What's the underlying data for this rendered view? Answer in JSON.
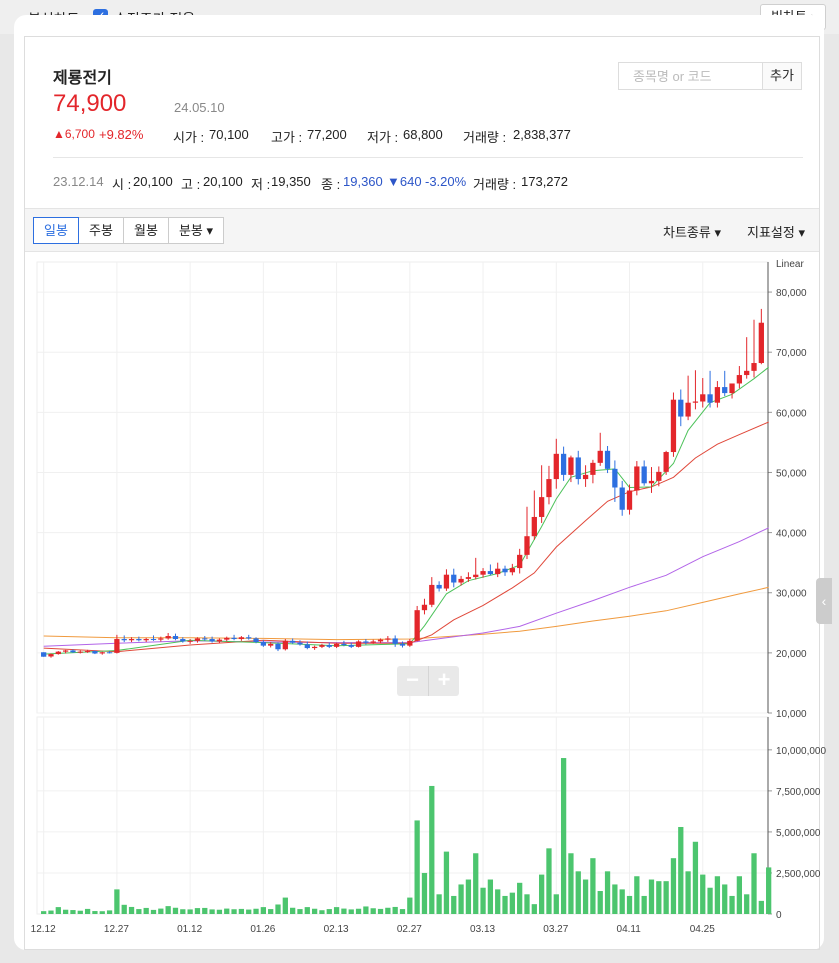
{
  "header": {
    "title": "분석차트",
    "adjusted_price_label": "수정주가 적용",
    "adjusted_price_checked": true,
    "big_chart_label": "빅차트 ›"
  },
  "stock": {
    "name": "제룡전기",
    "price": "74,900",
    "date": "24.05.10",
    "change": "▲6,700",
    "change_pct": "+9.82%",
    "open_label": "시가 :",
    "open": "70,100",
    "high_label": "고가 :",
    "high": "77,200",
    "low_label": "저가 :",
    "low": "68,800",
    "volume_label": "거래량 :",
    "volume": "2,838,377"
  },
  "search": {
    "placeholder": "종목명 or 코드",
    "add_label": "추가"
  },
  "hover_candle": {
    "date": "23.12.14",
    "open_label": "시 :",
    "open": "20,100",
    "high_label": "고 :",
    "high": "20,100",
    "low_label": "저 :",
    "low": "19,350",
    "close_label": "종 :",
    "close": "19,360",
    "change": "▼640",
    "change_pct": "-3.20%",
    "volume_label": "거래량 :",
    "volume": "173,272"
  },
  "toolbar": {
    "tabs": [
      "일봉",
      "주봉",
      "월봉",
      "분봉 ▾"
    ],
    "active_tab": 0,
    "chart_type_label": "차트종류 ▾",
    "indicator_label": "지표설정 ▾"
  },
  "colors": {
    "up": "#e3262b",
    "down": "#2d6fe0",
    "ma5": "#4cc25a",
    "ma20": "#e0483a",
    "ma60": "#b264e8",
    "ma120": "#f09a3e",
    "volume": "#4cc56e"
  },
  "chart_data": {
    "type": "candlestick",
    "scale_label": "Linear",
    "price_ticks": [
      "80,000",
      "70,000",
      "60,000",
      "50,000",
      "40,000",
      "30,000",
      "20,000",
      "10,000"
    ],
    "price_tick_values": [
      80000,
      70000,
      60000,
      50000,
      40000,
      30000,
      20000,
      10000
    ],
    "ylim": [
      10000,
      85000
    ],
    "volume_ticks": [
      "10,000,000",
      "7,500,000",
      "5,000,000",
      "2,500,000",
      "0"
    ],
    "volume_tick_values": [
      10000000,
      7500000,
      5000000,
      2500000,
      0
    ],
    "volume_ylim": [
      0,
      12000000
    ],
    "x_labels": [
      "12.12",
      "12.27",
      "01.12",
      "01.26",
      "02.13",
      "02.27",
      "03.13",
      "03.27",
      "04.11",
      "04.25"
    ],
    "x_label_index": [
      0,
      10,
      20,
      30,
      40,
      50,
      60,
      70,
      80,
      90
    ],
    "candles": [
      [
        20100,
        20100,
        19350,
        19360
      ],
      [
        19400,
        19900,
        19200,
        19800
      ],
      [
        19800,
        20300,
        19700,
        20200
      ],
      [
        20200,
        20500,
        19900,
        20400
      ],
      [
        20400,
        20600,
        20000,
        20100
      ],
      [
        20100,
        20400,
        19900,
        20200
      ],
      [
        20200,
        20500,
        20000,
        20300
      ],
      [
        20300,
        20400,
        19800,
        19900
      ],
      [
        19900,
        20200,
        19700,
        20100
      ],
      [
        20100,
        20300,
        19900,
        20000
      ],
      [
        20000,
        23000,
        19900,
        22300
      ],
      [
        22300,
        22900,
        21800,
        22100
      ],
      [
        22100,
        22600,
        21800,
        22300
      ],
      [
        22300,
        22700,
        21900,
        22100
      ],
      [
        22100,
        22500,
        21800,
        22300
      ],
      [
        22300,
        22900,
        22000,
        22200
      ],
      [
        22200,
        22700,
        21900,
        22400
      ],
      [
        22400,
        23300,
        22200,
        22800
      ],
      [
        22800,
        23200,
        22100,
        22300
      ],
      [
        22300,
        22600,
        21700,
        21900
      ],
      [
        21900,
        22300,
        21500,
        22000
      ],
      [
        22000,
        22600,
        21700,
        22400
      ],
      [
        22400,
        22800,
        22000,
        22300
      ],
      [
        22300,
        22700,
        21700,
        21900
      ],
      [
        21900,
        22400,
        21600,
        22200
      ],
      [
        22200,
        22700,
        21900,
        22500
      ],
      [
        22500,
        23000,
        22100,
        22300
      ],
      [
        22300,
        22800,
        22000,
        22600
      ],
      [
        22600,
        23000,
        22200,
        22400
      ],
      [
        22400,
        22600,
        21600,
        21800
      ],
      [
        21800,
        22100,
        21000,
        21200
      ],
      [
        21200,
        21800,
        20900,
        21500
      ],
      [
        21500,
        21700,
        20300,
        20600
      ],
      [
        20600,
        22300,
        20400,
        22000
      ],
      [
        22000,
        22400,
        21500,
        21700
      ],
      [
        21700,
        22100,
        21200,
        21400
      ],
      [
        21400,
        21900,
        20600,
        20800
      ],
      [
        20800,
        21200,
        20500,
        21000
      ],
      [
        21000,
        21500,
        20800,
        21300
      ],
      [
        21300,
        21700,
        20800,
        21000
      ],
      [
        21000,
        21700,
        20800,
        21500
      ],
      [
        21500,
        22000,
        21100,
        21300
      ],
      [
        21300,
        21700,
        20800,
        21000
      ],
      [
        21000,
        22100,
        20900,
        21900
      ],
      [
        21900,
        22300,
        21400,
        21700
      ],
      [
        21700,
        22200,
        21500,
        21900
      ],
      [
        21900,
        22400,
        21600,
        22200
      ],
      [
        22200,
        22800,
        21800,
        22400
      ],
      [
        22400,
        22900,
        21000,
        21500
      ],
      [
        21500,
        21900,
        20900,
        21200
      ],
      [
        21200,
        22300,
        21000,
        22000
      ],
      [
        22000,
        27800,
        21900,
        27100
      ],
      [
        27100,
        29000,
        26400,
        28000
      ],
      [
        28000,
        32600,
        27600,
        31300
      ],
      [
        31300,
        31900,
        30200,
        30700
      ],
      [
        30700,
        33900,
        30300,
        33000
      ],
      [
        33000,
        34000,
        30900,
        31700
      ],
      [
        31700,
        32800,
        31200,
        32300
      ],
      [
        32300,
        33400,
        31800,
        32600
      ],
      [
        32600,
        35800,
        32200,
        33000
      ],
      [
        33000,
        34100,
        32500,
        33600
      ],
      [
        33600,
        34700,
        32900,
        33100
      ],
      [
        33100,
        35000,
        32600,
        34000
      ],
      [
        34000,
        34500,
        32800,
        33400
      ],
      [
        33400,
        34800,
        32900,
        34100
      ],
      [
        34100,
        37300,
        33200,
        36300
      ],
      [
        36300,
        44300,
        35600,
        39400
      ],
      [
        39400,
        47000,
        38800,
        42600
      ],
      [
        42600,
        51200,
        41600,
        45900
      ],
      [
        45900,
        51100,
        44700,
        48900
      ],
      [
        48900,
        55600,
        47300,
        53100
      ],
      [
        53100,
        54300,
        48600,
        49600
      ],
      [
        49600,
        52800,
        48400,
        52500
      ],
      [
        52500,
        53600,
        48000,
        48900
      ],
      [
        48900,
        51200,
        47600,
        49600
      ],
      [
        49600,
        52100,
        48200,
        51600
      ],
      [
        51600,
        56600,
        51100,
        53600
      ],
      [
        53600,
        54400,
        49900,
        50600
      ],
      [
        50600,
        52000,
        45100,
        47500
      ],
      [
        47500,
        48600,
        42800,
        43800
      ],
      [
        43800,
        48000,
        43000,
        47000
      ],
      [
        47000,
        51900,
        46200,
        51000
      ],
      [
        51000,
        52000,
        47800,
        48200
      ],
      [
        48200,
        50900,
        46600,
        48600
      ],
      [
        48600,
        51000,
        47700,
        50100
      ],
      [
        50100,
        53600,
        49600,
        53400
      ],
      [
        53400,
        63300,
        52600,
        62100
      ],
      [
        62100,
        63800,
        57700,
        59300
      ],
      [
        59300,
        66100,
        58700,
        61600
      ],
      [
        61600,
        67000,
        60500,
        61800
      ],
      [
        61800,
        65700,
        60800,
        63000
      ],
      [
        63000,
        66900,
        60800,
        61600
      ],
      [
        61600,
        65200,
        60800,
        64200
      ],
      [
        64200,
        66900,
        62700,
        63200
      ],
      [
        63200,
        64400,
        62300,
        64800
      ],
      [
        64800,
        67700,
        64000,
        66200
      ],
      [
        66200,
        72500,
        65600,
        66900
      ],
      [
        66900,
        75400,
        65800,
        68200
      ],
      [
        68200,
        77200,
        68000,
        74900
      ]
    ],
    "volumes": [
      173272,
      210000,
      420000,
      260000,
      240000,
      200000,
      310000,
      180000,
      170000,
      220000,
      1500000,
      560000,
      430000,
      300000,
      370000,
      250000,
      330000,
      480000,
      380000,
      290000,
      280000,
      360000,
      370000,
      280000,
      260000,
      330000,
      290000,
      310000,
      270000,
      320000,
      420000,
      300000,
      580000,
      1000000,
      380000,
      300000,
      420000,
      320000,
      230000,
      300000,
      420000,
      330000,
      280000,
      320000,
      460000,
      350000,
      310000,
      380000,
      430000,
      300000,
      1000000,
      5700000,
      2500000,
      7800000,
      1200000,
      3800000,
      1100000,
      1800000,
      2100000,
      3700000,
      1600000,
      2100000,
      1500000,
      1100000,
      1300000,
      1900000,
      1200000,
      600000,
      2400000,
      4000000,
      1200000,
      9500000,
      3700000,
      2600000,
      2100000,
      3400000,
      1400000,
      2600000,
      1800000,
      1500000,
      1100000,
      2300000,
      1100000,
      2100000,
      2000000,
      2000000,
      3400000,
      5300000,
      2600000,
      4400000,
      2400000,
      1600000,
      2300000,
      1800000,
      1100000,
      2300000,
      1200000,
      3700000,
      800000,
      2838377
    ],
    "ma5_points": [
      [
        0,
        19800
      ],
      [
        10,
        20400
      ],
      [
        20,
        22100
      ],
      [
        30,
        21700
      ],
      [
        40,
        21200
      ],
      [
        50,
        21500
      ],
      [
        52,
        24500
      ],
      [
        55,
        29800
      ],
      [
        58,
        32000
      ],
      [
        62,
        33200
      ],
      [
        65,
        34600
      ],
      [
        68,
        41000
      ],
      [
        70,
        45600
      ],
      [
        72,
        49200
      ],
      [
        75,
        50300
      ],
      [
        78,
        50600
      ],
      [
        80,
        47500
      ],
      [
        83,
        47600
      ],
      [
        86,
        51500
      ],
      [
        88,
        57000
      ],
      [
        91,
        61600
      ],
      [
        94,
        63000
      ],
      [
        97,
        65600
      ],
      [
        99,
        67500
      ]
    ],
    "ma20_points": [
      [
        0,
        20800
      ],
      [
        10,
        20200
      ],
      [
        20,
        21300
      ],
      [
        30,
        22100
      ],
      [
        40,
        21600
      ],
      [
        50,
        21600
      ],
      [
        53,
        23000
      ],
      [
        56,
        25500
      ],
      [
        60,
        27900
      ],
      [
        64,
        30800
      ],
      [
        67,
        33300
      ],
      [
        70,
        37600
      ],
      [
        74,
        42000
      ],
      [
        77,
        45200
      ],
      [
        80,
        46800
      ],
      [
        83,
        47600
      ],
      [
        86,
        49200
      ],
      [
        89,
        52400
      ],
      [
        92,
        54700
      ],
      [
        95,
        56300
      ],
      [
        99,
        58400
      ]
    ],
    "ma60_points": [
      [
        0,
        21100
      ],
      [
        10,
        21600
      ],
      [
        20,
        22000
      ],
      [
        30,
        21800
      ],
      [
        40,
        21700
      ],
      [
        50,
        21700
      ],
      [
        55,
        22500
      ],
      [
        60,
        23300
      ],
      [
        65,
        24400
      ],
      [
        70,
        26600
      ],
      [
        75,
        28700
      ],
      [
        80,
        30900
      ],
      [
        85,
        32900
      ],
      [
        90,
        36000
      ],
      [
        95,
        38500
      ],
      [
        99,
        40800
      ]
    ],
    "ma120_points": [
      [
        0,
        22800
      ],
      [
        10,
        22500
      ],
      [
        20,
        22500
      ],
      [
        30,
        22400
      ],
      [
        40,
        22200
      ],
      [
        50,
        22300
      ],
      [
        55,
        22700
      ],
      [
        60,
        23100
      ],
      [
        65,
        23600
      ],
      [
        70,
        24400
      ],
      [
        75,
        25300
      ],
      [
        80,
        26100
      ],
      [
        85,
        27000
      ],
      [
        90,
        28400
      ],
      [
        95,
        29800
      ],
      [
        99,
        30900
      ]
    ]
  }
}
